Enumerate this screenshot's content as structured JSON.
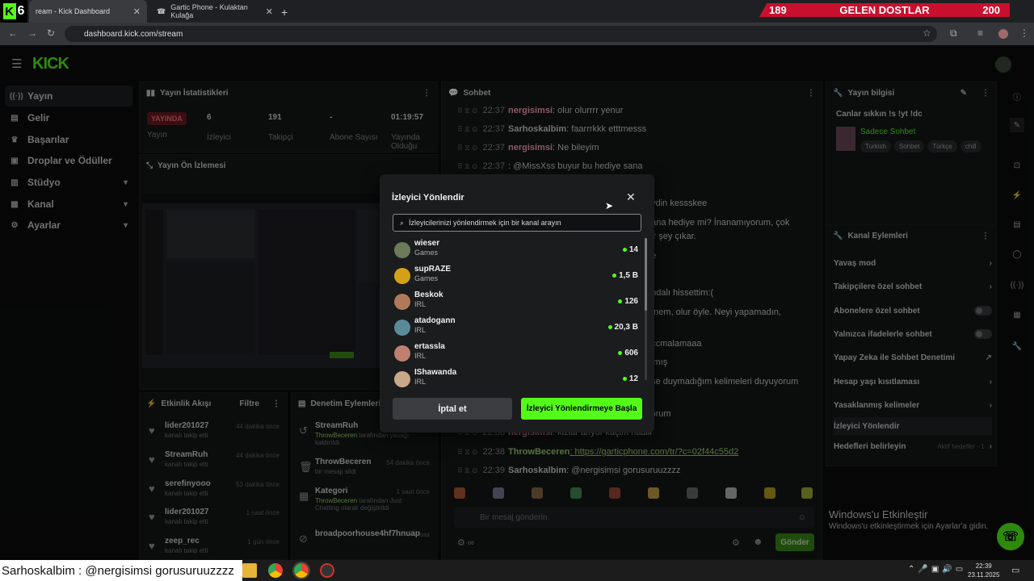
{
  "browser": {
    "tabs": [
      {
        "title": "ream - Kick Dashboard"
      },
      {
        "title": "Gartic Phone - Kulaktan Kulağa"
      }
    ],
    "kick_badge_number": "6",
    "url": "dashboard.kick.com/stream",
    "banner": {
      "left": "189",
      "title": "GELEN DOSTLAR",
      "right": "200"
    }
  },
  "brand": "KICK",
  "sidebar": {
    "items": [
      {
        "label": "Yayın",
        "icon": "broadcast-icon"
      },
      {
        "label": "Gelir",
        "icon": "wallet-icon"
      },
      {
        "label": "Başarılar",
        "icon": "trophy-icon"
      },
      {
        "label": "Droplar ve Ödüller",
        "icon": "gift-icon"
      },
      {
        "label": "Stüdyo",
        "icon": "studio-icon"
      },
      {
        "label": "Kanal",
        "icon": "channel-icon"
      },
      {
        "label": "Ayarlar",
        "icon": "gear-icon"
      }
    ]
  },
  "stats": {
    "title": "Yayın İstatistikleri",
    "live": "YAYINDA",
    "live_label": "Yayın",
    "viewers": "6",
    "viewers_label": "İzleyici",
    "followers": "191",
    "followers_label": "Takipçi",
    "subs": "-",
    "subs_label": "Abone Sayısı",
    "uptime": "01:19:57",
    "uptime_label": "Yayında Olduğu"
  },
  "preview": {
    "title": "Yayın Ön İzlemesi"
  },
  "activity": {
    "title": "Etkinlik Akışı",
    "filter": "Filtre",
    "rows": [
      {
        "name": "lider201027",
        "sub": "kanalı takip etti",
        "time": "44 dakika önce"
      },
      {
        "name": "StreamRuh",
        "sub": "kanalı takip etti",
        "time": "44 dakika önce"
      },
      {
        "name": "serefinyooo",
        "sub": "kanalı takip etti",
        "time": "53 dakika önce"
      },
      {
        "name": "lider201027",
        "sub": "kanalı takip etti",
        "time": "1 saat önce"
      },
      {
        "name": "zeep_rec",
        "sub": "kanalı takip etti",
        "time": "1 gün önce"
      }
    ]
  },
  "modlog": {
    "title": "Denetim Eylemleri",
    "rows": [
      {
        "name": "StreamRuh",
        "who": "ThrowBeceren",
        "rest": "tarafından yasağı kaldırıldı",
        "time": ""
      },
      {
        "name": "ThrowBeceren",
        "who": "",
        "rest": "bir mesajı sildi",
        "time": "54 dakika önce"
      },
      {
        "name": "Kategori",
        "who": "ThrowBeceren",
        "rest": "tarafından Just Chatting olarak değiştirildi",
        "time": "1 saat önce"
      },
      {
        "name": "broadpoorhouse4hf7hnuap",
        "who": "",
        "rest": "",
        "time": "saa"
      }
    ]
  },
  "chat": {
    "title": "Sohbet",
    "lines": [
      {
        "time": "22:37",
        "user": "nergisimsi",
        "text": ": olur olurrrr yenur",
        "style": "u1"
      },
      {
        "time": "22:37",
        "user": "Sarhoskalbim",
        "text": ": faarrrkkk etttmesss",
        "style": "u2"
      },
      {
        "time": "22:37",
        "user": "nergisimsi",
        "text": ": Ne bileyim",
        "style": "u1"
      },
      {
        "time": "22:37",
        "user": "",
        "text": ": @MissXss buyur bu hediye sana",
        "style": "u1"
      },
      {
        "time": "",
        "user": "",
        "text": "aydin kessskee",
        "style": "u2"
      },
      {
        "time": "",
        "user": "",
        "text": "bana hediye mi? İnanamıyorum, çok",
        "style": "u2"
      },
      {
        "time": "",
        "user": "",
        "text": "bir şey çıkar.",
        "style": "u2"
      },
      {
        "time": "",
        "user": "",
        "text": "be",
        "style": "u2"
      },
      {
        "time": "",
        "user": "",
        "text": "andalı hissettim:(",
        "style": "u2"
      },
      {
        "time": "",
        "user": "",
        "text": "tanem, olur öyle. Neyi yapamadın,",
        "style": "u2"
      },
      {
        "time": "",
        "user": "",
        "text": "accmalamaaa",
        "style": "u2"
      },
      {
        "time": "",
        "user": "",
        "text": "almış",
        "style": "u2"
      },
      {
        "time": "",
        "user": "",
        "text": "nse duymadığım kelimeleri duyuyorum",
        "style": "u2"
      },
      {
        "time": "",
        "user": "",
        "text": "yorum",
        "style": "u2"
      },
      {
        "time": "22:38",
        "user": "nergisimsi",
        "text": ": kizlar ariyor kaçim hadiii",
        "style": "u1"
      },
      {
        "time": "22:38",
        "user": "ThrowBeceren",
        "text": ": https://garticphone.com/tr/?c=02f44c55d2",
        "style": "u3"
      },
      {
        "time": "22:39",
        "user": "Sarhoskalbim",
        "text": ": @nergisimsi gorusuruuzzzz",
        "style": "u2"
      }
    ],
    "input_placeholder": "Bir mesaj gönderin",
    "send": "Gönder"
  },
  "info": {
    "title": "Yayın bilgisi",
    "stream_title": "Canlar sıkkın !s !yt !dc",
    "category": "Sadece Sohbet",
    "tags": [
      "Turkish",
      "Sohbet",
      "Türkçe",
      "chill"
    ]
  },
  "channel_actions": {
    "title": "Kanal Eylemleri",
    "items": [
      {
        "label": "Yavaş mod",
        "kind": "chevron"
      },
      {
        "label": "Takipçilere özel sohbet",
        "kind": "chevron"
      },
      {
        "label": "Abonelere özel sohbet",
        "kind": "toggle"
      },
      {
        "label": "Yalnızca ifadelerle sohbet",
        "kind": "toggle"
      },
      {
        "label": "Yapay Zeka ile Sohbet Denetimi",
        "kind": "external"
      },
      {
        "label": "Hesap yaşı kısıtlaması",
        "kind": "chevron"
      },
      {
        "label": "Yasaklanmış kelimeler",
        "kind": "chevron"
      },
      {
        "label": "İzleyici Yönlendir",
        "kind": "none"
      },
      {
        "label": "Hedefleri belirleyin",
        "kind": "goal",
        "extra": "Aktif hedefler - 1"
      }
    ]
  },
  "windows_activation": {
    "title": "Windows'u Etkinleştir",
    "sub": "Windows'u etkinleştirmek için Ayarlar'a gidin."
  },
  "modal": {
    "title": "İzleyici Yönlendir",
    "search_placeholder": "İzleyicilerinizi yönlendirmek için bir kanal arayın",
    "channels": [
      {
        "name": "wieser",
        "category": "Games",
        "viewers": "14",
        "color": "#6b7a5a"
      },
      {
        "name": "supRAZE",
        "category": "Games",
        "viewers": "1,5 B",
        "color": "#d4a017"
      },
      {
        "name": "Beskok",
        "category": "IRL",
        "viewers": "126",
        "color": "#b07a5a"
      },
      {
        "name": "atadogann",
        "category": "IRL",
        "viewers": "20,3 B",
        "color": "#5a8a9a"
      },
      {
        "name": "ertassla",
        "category": "IRL",
        "viewers": "606",
        "color": "#c08070"
      },
      {
        "name": "IShawanda",
        "category": "IRL",
        "viewers": "12",
        "color": "#c9a88a"
      }
    ],
    "cancel": "İptal et",
    "start": "İzleyici Yönlendirmeye Başla"
  },
  "taskbar": {
    "ticker": "Sarhoskalbim : @nergisimsi gorusuruuzzzz",
    "time": "22:39",
    "date": "23.11.2025"
  }
}
